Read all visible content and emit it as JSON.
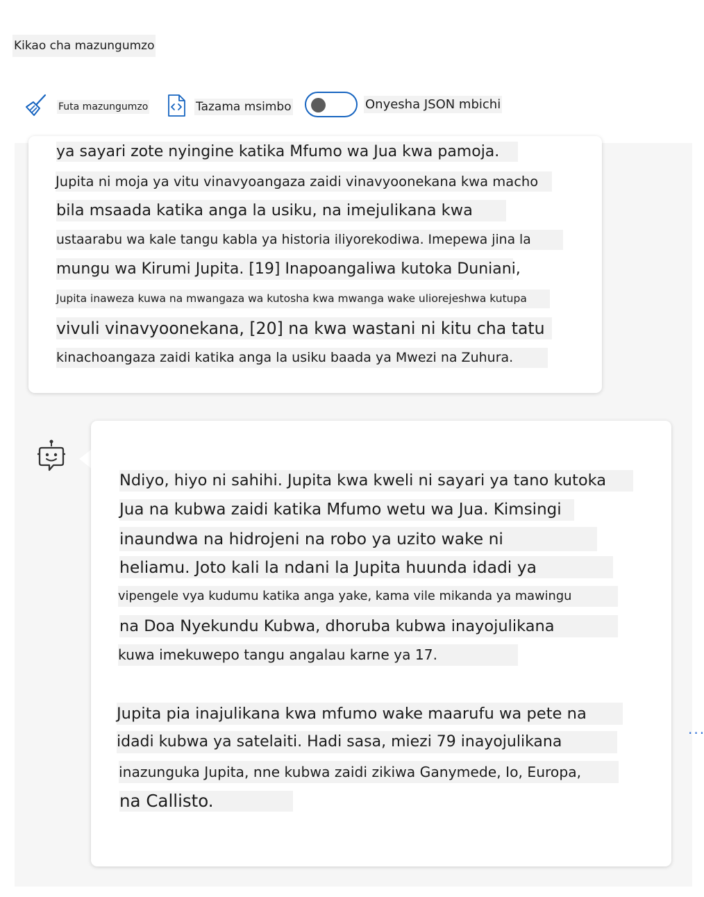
{
  "header": {
    "title": "Kikao cha mazungumzo"
  },
  "toolbar": {
    "clear_label": "Futa mazungumzo",
    "view_code_label": "Tazama msimbo",
    "raw_json_label": "Onyesha JSON mbichi",
    "raw_json_enabled": false
  },
  "messages": {
    "user_lines": [
      "ya sayari zote nyingine katika Mfumo wa Jua kwa pamoja.",
      "Jupita ni moja ya vitu vinavyoangaza zaidi vinavyoonekana kwa macho",
      "bila msaada katika anga la usiku, na imejulikana kwa",
      "ustaarabu wa kale tangu kabla ya historia iliyorekodiwa. Imepewa jina la",
      "mungu wa Kirumi Jupita. [19] Inapoangaliwa kutoka Duniani,",
      "Jupita inaweza kuwa na mwangaza wa kutosha kwa mwanga wake uliorejeshwa kutupa",
      "vivuli vinavyoonekana, [20] na kwa wastani ni kitu cha tatu",
      "kinachoangaza zaidi katika anga la usiku baada ya Mwezi na Zuhura."
    ],
    "bot_more": "...",
    "bot_lines": [
      "Ndiyo, hiyo ni sahihi. Jupita kwa kweli ni sayari ya tano kutoka",
      "Jua na kubwa zaidi katika Mfumo wetu wa Jua. Kimsingi",
      "inaundwa na hidrojeni na robo ya uzito wake ni",
      "heliamu. Joto kali la ndani la Jupita huunda idadi ya",
      "vipengele vya kudumu katika anga yake, kama vile mikanda ya mawingu",
      "na Doa Nyekundu Kubwa, dhoruba kubwa inayojulikana",
      "kuwa imekuwepo tangu angalau karne ya 17.",
      "Jupita pia inajulikana kwa mfumo wake maarufu wa pete na",
      "idadi kubwa ya satelaiti. Hadi sasa, miezi 79 inayojulikana",
      "inazunguka Jupita, nne kubwa zaidi zikiwa Ganymede, Io, Europa,",
      "na Callisto."
    ]
  },
  "colors": {
    "accent": "#1664c0",
    "line_highlight": "#f2f2f2",
    "chat_background": "#f6f6f6"
  },
  "icons": {
    "clear": "broom-icon",
    "code": "code-file-icon",
    "bot": "robot-icon"
  }
}
